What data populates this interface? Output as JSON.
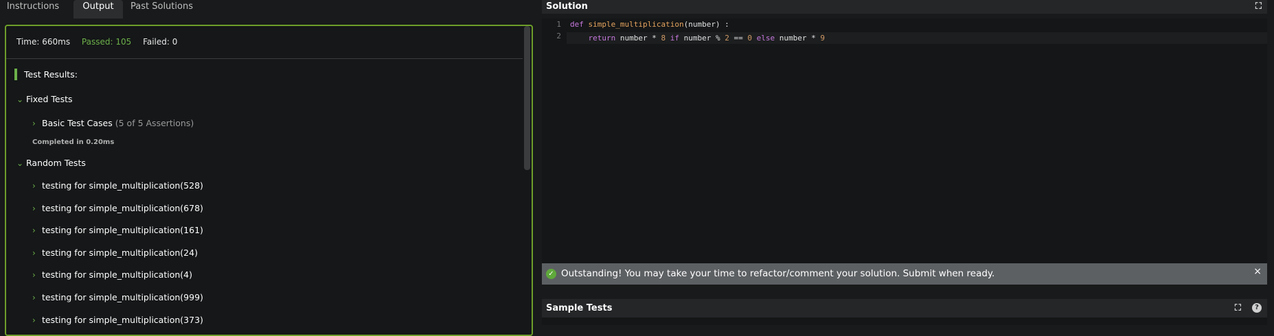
{
  "tabs": [
    "Instructions",
    "Output",
    "Past Solutions"
  ],
  "stats": {
    "time": "Time: 660ms",
    "passed": "Passed: 105",
    "failed": "Failed: 0"
  },
  "results_title": "Test Results:",
  "fixed_tests": {
    "label": "Fixed Tests",
    "basic_label": "Basic Test Cases",
    "basic_assertions": "(5 of 5 Assertions)",
    "completed": "Completed in 0.20ms"
  },
  "random_tests": {
    "label": "Random Tests",
    "items": [
      "testing for simple_multiplication(528)",
      "testing for simple_multiplication(678)",
      "testing for simple_multiplication(161)",
      "testing for simple_multiplication(24)",
      "testing for simple_multiplication(4)",
      "testing for simple_multiplication(999)",
      "testing for simple_multiplication(373)"
    ]
  },
  "solution": {
    "title": "Solution",
    "line_numbers": [
      "1",
      "2"
    ],
    "code": [
      "def simple_multiplication(number) :",
      "    return number * 8 if number % 2 == 0 else number * 9"
    ]
  },
  "success_message": "Outstanding! You may take your time to refactor/comment your solution. Submit when ready.",
  "sample_tests_title": "Sample Tests",
  "colors": {
    "accent_green": "#6cb04a",
    "panel_border": "#6e9e2a",
    "success_bar": "#5d6063"
  },
  "icons": [
    "chevron-right-icon",
    "chevron-down-icon",
    "expand-icon",
    "check-circle-icon",
    "close-icon",
    "help-icon"
  ]
}
